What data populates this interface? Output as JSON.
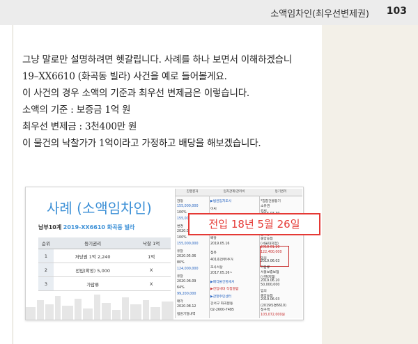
{
  "header": {
    "chapter": "소액임차인(최우선변제권)",
    "page_number": "103"
  },
  "body_lines": [
    "그냥 말로만 설명하려면 헷갈립니다. 사례를 하나 보면서 이해하겠습니",
    "19–XX6610 (화곡동 빌라) 사건을 예로 들어볼게요.",
    "이 사건의 경우 소액의 기준과 최우선 변제금은 이렇습니다.",
    "소액의 기준 : 보증금 1억 원",
    "최우선 변제금 : 3천400만 원",
    "이 물건의 낙찰가가 1억이라고 가정하고 배당을 해보겠습니다."
  ],
  "figure": {
    "title": "사례 (소액임차인)",
    "subtitle_prefix": "남부10계",
    "subtitle_case": "2019-XX6610 화곡동 빌라",
    "table": {
      "headers": [
        "순위",
        "등기권리",
        "낙찰 1억"
      ],
      "rows": [
        [
          "1",
          "저당권 1억 2,240",
          "1억"
        ],
        [
          "2",
          "전입(확정) 5,000",
          "X"
        ],
        [
          "3",
          "가압류",
          "X"
        ]
      ]
    },
    "doc": {
      "col_headers": [
        "진행결과",
        "임차관계/관리비",
        "등기권리"
      ],
      "col1": [
        "감정",
        "155,000,000",
        "100%",
        "155,000,000",
        "변경",
        "2020.04.01",
        "100%",
        "155,000,000",
        "유찰",
        "2020.05.06",
        "80%",
        "124,000,000",
        "유찰",
        "2020.06.09",
        "64%",
        "99,200,000",
        "매각",
        "2020.08.12",
        "법원기일내역"
      ],
      "col2": [
        "▶법원임차조사",
        "이씨",
        "전입",
        "2018.05.26",
        "확정",
        "배당",
        "2019.05.16",
        "점유",
        "401호전부/주거",
        "조사서상",
        "2017.05.26~",
        "▶매각물건명세서",
        "▶전입세대 직접열람",
        "▶관할주민센터",
        "강서구 화곡본동",
        "02-2600-7485"
      ],
      "col3": [
        "*집합건물등기",
        "소유권",
        "김씨",
        "2015.03.30",
        "전소유자:",
        "조씨",
        "매매(2015.03.05)",
        "근저당",
        "중앙농협",
        "(서울대지점)",
        "2018.01.20",
        "122,400,000",
        "임의",
        "2019.06.03",
        "가압류",
        "서울보증보험",
        "(신월지점)",
        "2019.06.20",
        "50,000,000",
        "임의",
        "중앙농협",
        "2019.06.03",
        "(2019타경6610)",
        "청구액",
        "103,072,000원"
      ]
    },
    "callout": "전입 18년 5월 26일"
  },
  "colors": {
    "accent_blue": "#3b8fd6",
    "callout_red": "#e53935",
    "sidebar": "#f3f0e8",
    "header": "#ececec"
  }
}
